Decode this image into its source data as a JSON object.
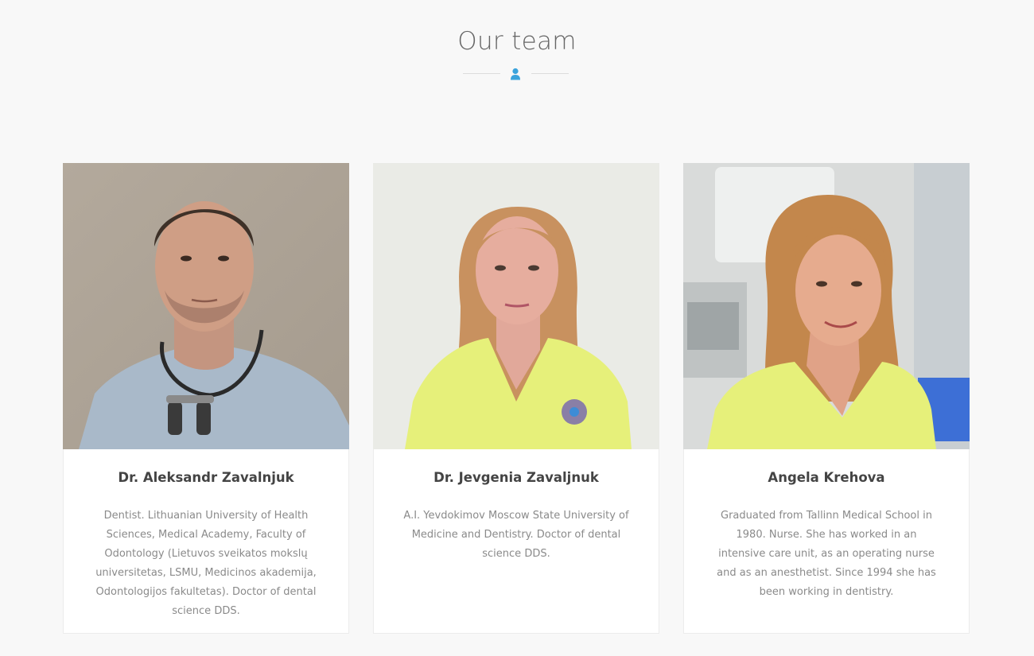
{
  "section": {
    "title": "Our team",
    "divider_icon": "user-icon",
    "accent_color": "#3aa3dc"
  },
  "team": [
    {
      "name": "Dr. Aleksandr Zavalnjuk",
      "bio": "Dentist. Lithuanian University of Health Sciences, Medical Academy, Faculty of Odontology (Lietuvos sveikatos mokslų universitetas, LSMU, Medicinos akademija, Odontologijos fakultetas). Doctor of dental science DDS."
    },
    {
      "name": "Dr. Jevgenia Zavaljnuk",
      "bio": "A.I. Yevdokimov Moscow State University of Medicine and Dentistry. Doctor of dental science DDS."
    },
    {
      "name": "Angela Krehova",
      "bio": "Graduated from Tallinn Medical School in 1980. Nurse. She has worked in an intensive care unit, as an operating nurse and as an anesthetist. Since 1994 she has been working in dentistry."
    }
  ]
}
